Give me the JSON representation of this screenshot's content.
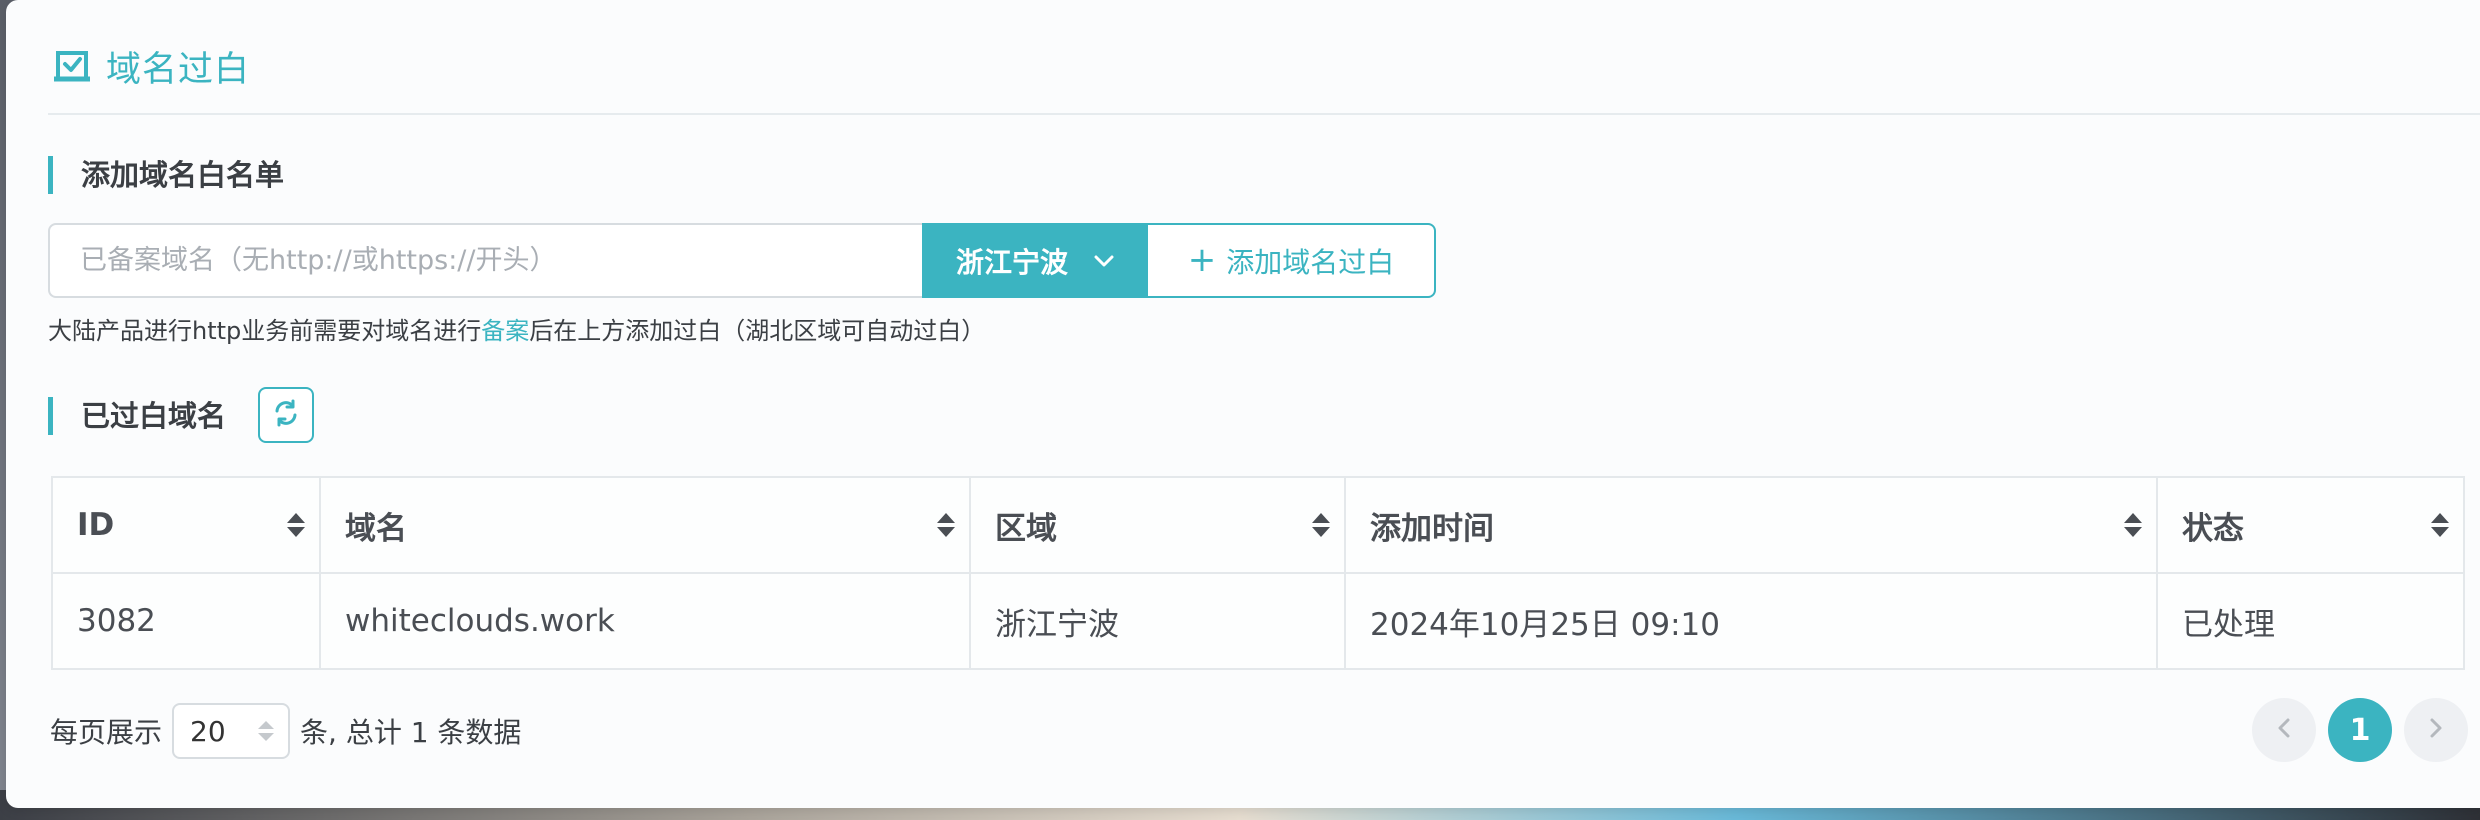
{
  "page": {
    "title": "域名过白",
    "accent_color": "#3bb4c1",
    "title_icon": "whitelist-check-icon"
  },
  "add_section": {
    "title": "添加域名白名单",
    "input_placeholder": "已备案域名（无http://或https://开头）",
    "region_selected": "浙江宁波",
    "add_button_label": "添加域名过白",
    "hint_before": "大陆产品进行http业务前需要对域名进行",
    "hint_link": "备案",
    "hint_after": "后在上方添加过白（湖北区域可自动过白）"
  },
  "list_section": {
    "title": "已过白域名",
    "refresh_icon": "refresh-icon"
  },
  "table": {
    "columns": [
      "ID",
      "域名",
      "区域",
      "添加时间",
      "状态"
    ],
    "rows": [
      [
        "3082",
        "whiteclouds.work",
        "浙江宁波",
        "2024年10月25日 09:10",
        "已处理"
      ]
    ]
  },
  "pagination": {
    "per_page_label": "每页展示",
    "page_size": "20",
    "summary": "条, 总计 1 条数据",
    "current_page": "1"
  }
}
